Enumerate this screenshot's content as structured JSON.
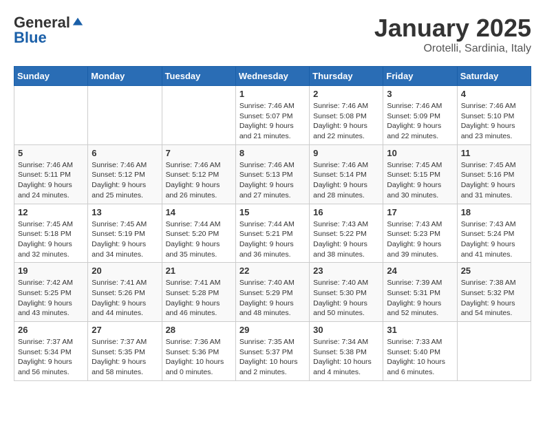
{
  "header": {
    "logo_general": "General",
    "logo_blue": "Blue",
    "month_title": "January 2025",
    "location": "Orotelli, Sardinia, Italy"
  },
  "weekdays": [
    "Sunday",
    "Monday",
    "Tuesday",
    "Wednesday",
    "Thursday",
    "Friday",
    "Saturday"
  ],
  "weeks": [
    [
      {
        "day": "",
        "info": ""
      },
      {
        "day": "",
        "info": ""
      },
      {
        "day": "",
        "info": ""
      },
      {
        "day": "1",
        "info": "Sunrise: 7:46 AM\nSunset: 5:07 PM\nDaylight: 9 hours\nand 21 minutes."
      },
      {
        "day": "2",
        "info": "Sunrise: 7:46 AM\nSunset: 5:08 PM\nDaylight: 9 hours\nand 22 minutes."
      },
      {
        "day": "3",
        "info": "Sunrise: 7:46 AM\nSunset: 5:09 PM\nDaylight: 9 hours\nand 22 minutes."
      },
      {
        "day": "4",
        "info": "Sunrise: 7:46 AM\nSunset: 5:10 PM\nDaylight: 9 hours\nand 23 minutes."
      }
    ],
    [
      {
        "day": "5",
        "info": "Sunrise: 7:46 AM\nSunset: 5:11 PM\nDaylight: 9 hours\nand 24 minutes."
      },
      {
        "day": "6",
        "info": "Sunrise: 7:46 AM\nSunset: 5:12 PM\nDaylight: 9 hours\nand 25 minutes."
      },
      {
        "day": "7",
        "info": "Sunrise: 7:46 AM\nSunset: 5:12 PM\nDaylight: 9 hours\nand 26 minutes."
      },
      {
        "day": "8",
        "info": "Sunrise: 7:46 AM\nSunset: 5:13 PM\nDaylight: 9 hours\nand 27 minutes."
      },
      {
        "day": "9",
        "info": "Sunrise: 7:46 AM\nSunset: 5:14 PM\nDaylight: 9 hours\nand 28 minutes."
      },
      {
        "day": "10",
        "info": "Sunrise: 7:45 AM\nSunset: 5:15 PM\nDaylight: 9 hours\nand 30 minutes."
      },
      {
        "day": "11",
        "info": "Sunrise: 7:45 AM\nSunset: 5:16 PM\nDaylight: 9 hours\nand 31 minutes."
      }
    ],
    [
      {
        "day": "12",
        "info": "Sunrise: 7:45 AM\nSunset: 5:18 PM\nDaylight: 9 hours\nand 32 minutes."
      },
      {
        "day": "13",
        "info": "Sunrise: 7:45 AM\nSunset: 5:19 PM\nDaylight: 9 hours\nand 34 minutes."
      },
      {
        "day": "14",
        "info": "Sunrise: 7:44 AM\nSunset: 5:20 PM\nDaylight: 9 hours\nand 35 minutes."
      },
      {
        "day": "15",
        "info": "Sunrise: 7:44 AM\nSunset: 5:21 PM\nDaylight: 9 hours\nand 36 minutes."
      },
      {
        "day": "16",
        "info": "Sunrise: 7:43 AM\nSunset: 5:22 PM\nDaylight: 9 hours\nand 38 minutes."
      },
      {
        "day": "17",
        "info": "Sunrise: 7:43 AM\nSunset: 5:23 PM\nDaylight: 9 hours\nand 39 minutes."
      },
      {
        "day": "18",
        "info": "Sunrise: 7:43 AM\nSunset: 5:24 PM\nDaylight: 9 hours\nand 41 minutes."
      }
    ],
    [
      {
        "day": "19",
        "info": "Sunrise: 7:42 AM\nSunset: 5:25 PM\nDaylight: 9 hours\nand 43 minutes."
      },
      {
        "day": "20",
        "info": "Sunrise: 7:41 AM\nSunset: 5:26 PM\nDaylight: 9 hours\nand 44 minutes."
      },
      {
        "day": "21",
        "info": "Sunrise: 7:41 AM\nSunset: 5:28 PM\nDaylight: 9 hours\nand 46 minutes."
      },
      {
        "day": "22",
        "info": "Sunrise: 7:40 AM\nSunset: 5:29 PM\nDaylight: 9 hours\nand 48 minutes."
      },
      {
        "day": "23",
        "info": "Sunrise: 7:40 AM\nSunset: 5:30 PM\nDaylight: 9 hours\nand 50 minutes."
      },
      {
        "day": "24",
        "info": "Sunrise: 7:39 AM\nSunset: 5:31 PM\nDaylight: 9 hours\nand 52 minutes."
      },
      {
        "day": "25",
        "info": "Sunrise: 7:38 AM\nSunset: 5:32 PM\nDaylight: 9 hours\nand 54 minutes."
      }
    ],
    [
      {
        "day": "26",
        "info": "Sunrise: 7:37 AM\nSunset: 5:34 PM\nDaylight: 9 hours\nand 56 minutes."
      },
      {
        "day": "27",
        "info": "Sunrise: 7:37 AM\nSunset: 5:35 PM\nDaylight: 9 hours\nand 58 minutes."
      },
      {
        "day": "28",
        "info": "Sunrise: 7:36 AM\nSunset: 5:36 PM\nDaylight: 10 hours\nand 0 minutes."
      },
      {
        "day": "29",
        "info": "Sunrise: 7:35 AM\nSunset: 5:37 PM\nDaylight: 10 hours\nand 2 minutes."
      },
      {
        "day": "30",
        "info": "Sunrise: 7:34 AM\nSunset: 5:38 PM\nDaylight: 10 hours\nand 4 minutes."
      },
      {
        "day": "31",
        "info": "Sunrise: 7:33 AM\nSunset: 5:40 PM\nDaylight: 10 hours\nand 6 minutes."
      },
      {
        "day": "",
        "info": ""
      }
    ]
  ]
}
